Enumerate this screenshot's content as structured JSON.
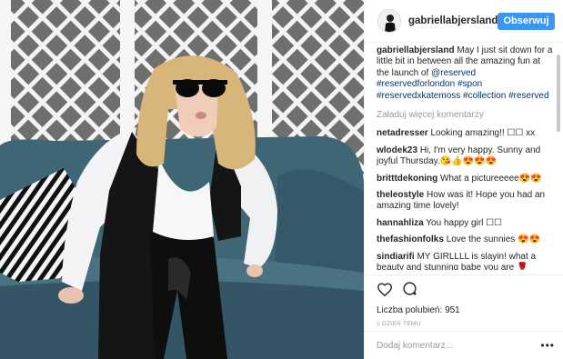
{
  "photo": {
    "description_icon": "post-photo"
  },
  "header": {
    "username": "gabriellabjersland",
    "follow_label": "Obserwuj"
  },
  "caption": {
    "username": "gabriellabjersland",
    "text": "May I just sit down for a little bit in between all the amazing fun at the launch of",
    "mention": "@reserved",
    "hashtags": "#reservedforlondon #spon #reservedxkatemoss #collection #reserved"
  },
  "load_more": "Załaduj więcej komentarzy",
  "comments": [
    {
      "user": "netadresser",
      "text": "Looking amazing!! ☐☐ xx"
    },
    {
      "user": "wlodek23",
      "text": "Hi, I'm very happy. Sunny and joyful Thursday.",
      "emoji": "😘👍😍😍😍"
    },
    {
      "user": "britttdekoning",
      "text": "What a pictureeeee",
      "emoji": "😍😍"
    },
    {
      "user": "theleostyle",
      "text": "How was it! Hope you had an amazing time lovely!"
    },
    {
      "user": "hannahliza",
      "text": "You happy girl ☐☐"
    },
    {
      "user": "thefashionfolks",
      "text": "Love the sunnies",
      "emoji": "😍😍"
    },
    {
      "user": "sindiarifi",
      "text": "MY GIRLLLL is slayin! what a beauty and stunning babe you are",
      "emoji_red": "🌹"
    }
  ],
  "actions": {
    "like_icon": "heart-icon",
    "comment_icon": "comment-bubble-icon",
    "likes_label": "Liczba polubień:",
    "likes_count": "951",
    "timestamp": "1 DZIEŃ TEMU"
  },
  "add_comment": {
    "placeholder": "Dodaj komentarz...",
    "more_icon": "more-options-icon",
    "more_label": "•••"
  },
  "colors": {
    "accent": "#3897f0",
    "sofa": "#3f6675",
    "lattice": "#f2f2f2"
  }
}
